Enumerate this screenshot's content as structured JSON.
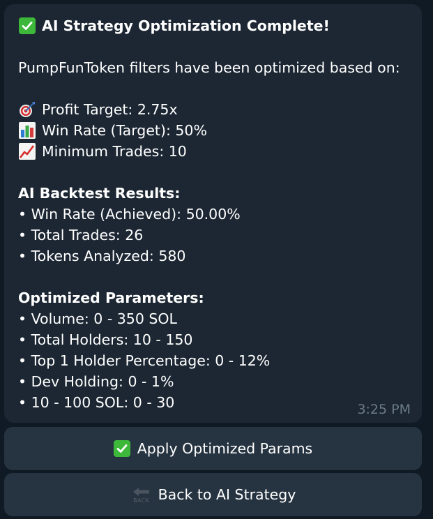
{
  "message": {
    "title": "AI Strategy Optimization Complete!",
    "intro": "PumpFunToken filters have been optimized based on:",
    "targets": [
      {
        "icon": "target-icon",
        "text": "Profit Target: 2.75x"
      },
      {
        "icon": "bar-chart-icon",
        "text": "Win Rate (Target): 50%"
      },
      {
        "icon": "chart-increasing-icon",
        "text": "Minimum Trades: 10"
      }
    ],
    "backtest_heading": "AI Backtest Results:",
    "backtest_items": [
      "• Win Rate (Achieved): 50.00%",
      "• Total Trades: 26",
      "• Tokens Analyzed: 580"
    ],
    "params_heading": "Optimized Parameters:",
    "params_items": [
      "• Volume: 0 - 350 SOL",
      "• Total Holders: 10 - 150",
      "• Top 1 Holder Percentage: 0 - 12%",
      "• Dev Holding: 0 - 1%",
      "• 10 - 100 SOL: 0 - 30"
    ],
    "time": "3:25 PM"
  },
  "buttons": {
    "apply_label": "Apply Optimized Params",
    "back_label": "Back to AI Strategy",
    "back_icon_text": "BACK"
  },
  "colors": {
    "background": "#0f1a24",
    "bubble": "#1c2733",
    "button": "#263441",
    "check_green": "#3db83a",
    "time_text": "#6d7b88"
  }
}
